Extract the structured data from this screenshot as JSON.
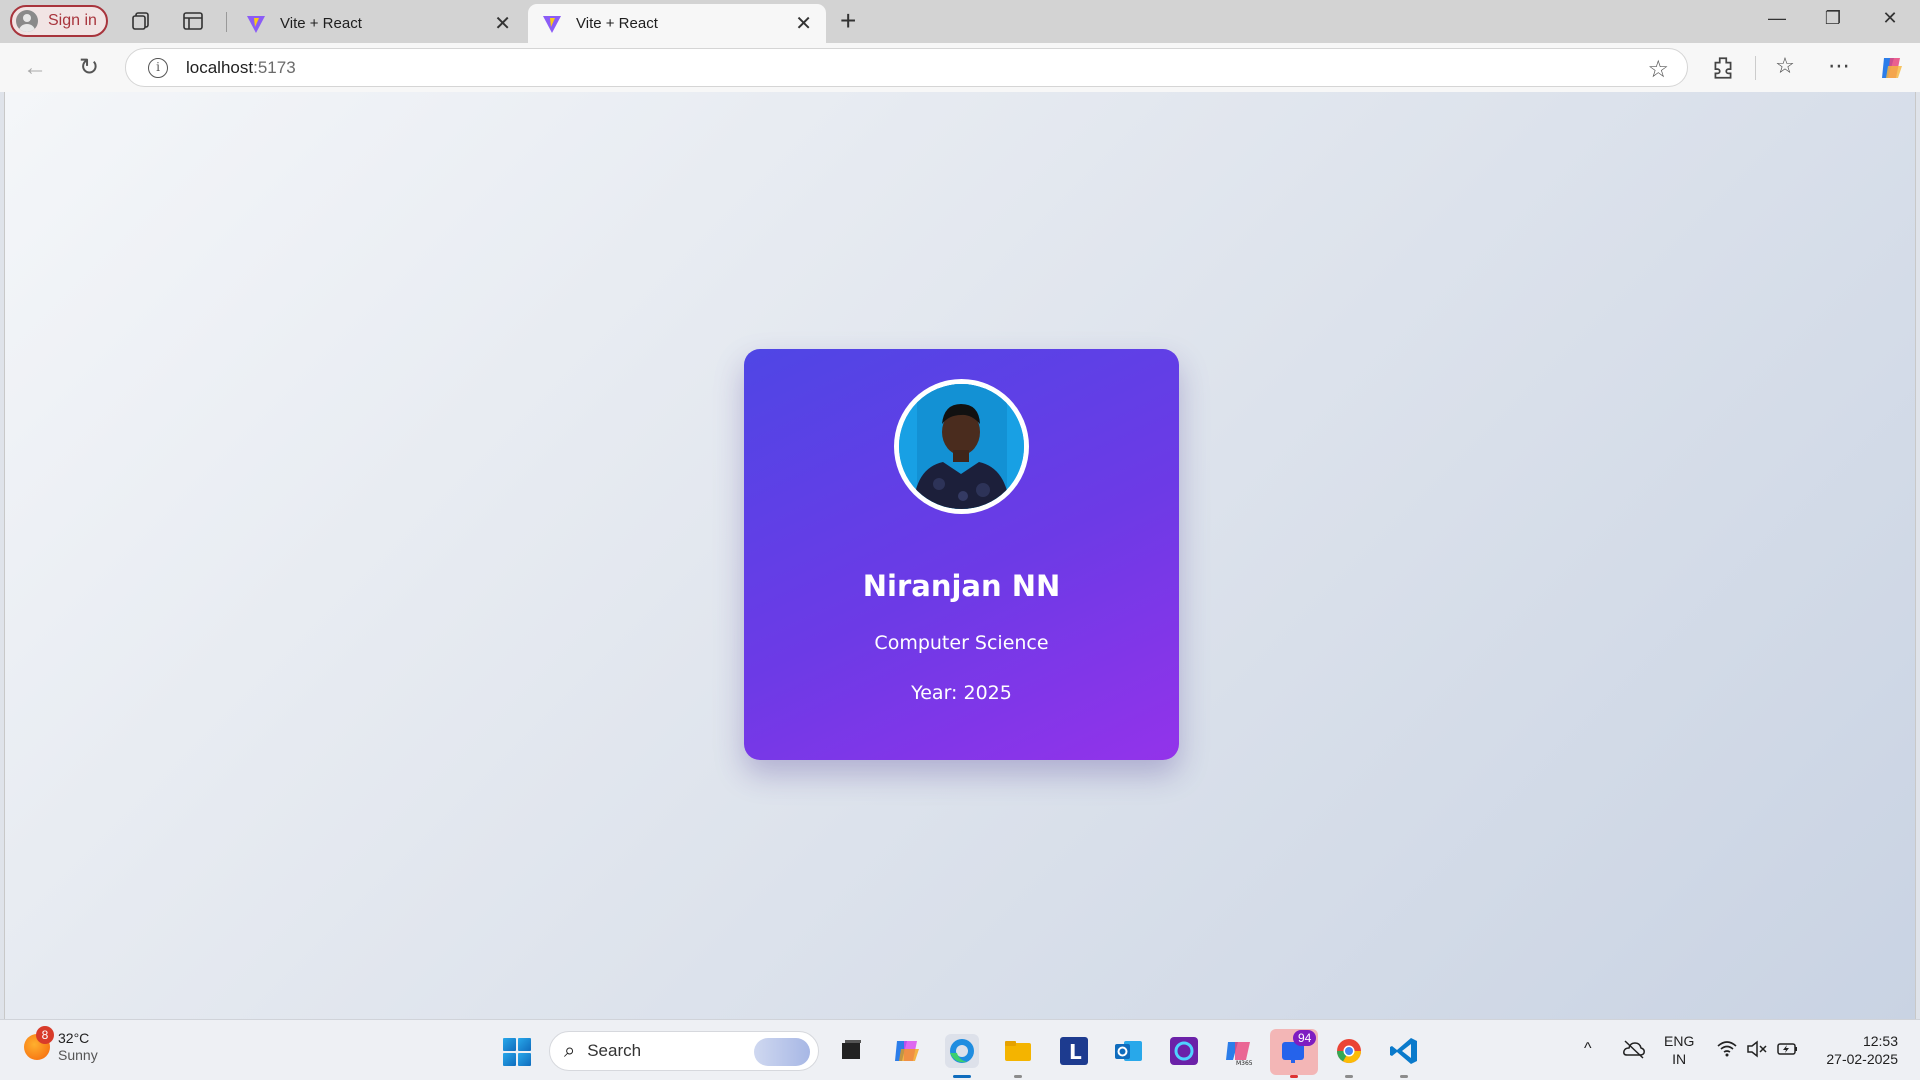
{
  "browser": {
    "signin_label": "Sign in",
    "tabs": [
      {
        "title": "Vite + React",
        "active": false
      },
      {
        "title": "Vite + React",
        "active": true
      }
    ],
    "address": {
      "host": "localhost",
      "port": ":5173"
    }
  },
  "card": {
    "name": "Niranjan NN",
    "department": "Computer Science",
    "year": "Year: 2025",
    "gradient_start": "#4f46e5",
    "gradient_end": "#9333ea"
  },
  "taskbar": {
    "weather": {
      "temp": "32°C",
      "condition": "Sunny",
      "badge": "8"
    },
    "search_placeholder": "Search",
    "teams_badge": "94",
    "language": {
      "line1": "ENG",
      "line2": "IN"
    },
    "clock": {
      "time": "12:53",
      "date": "27-02-2025"
    }
  }
}
